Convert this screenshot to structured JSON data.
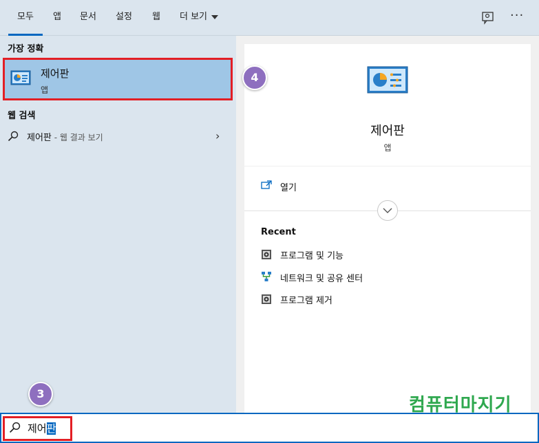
{
  "tabs": [
    {
      "label": "모두"
    },
    {
      "label": "앱"
    },
    {
      "label": "문서"
    },
    {
      "label": "설정"
    },
    {
      "label": "웹"
    },
    {
      "label": "더 보기"
    }
  ],
  "toolbar": {
    "feedback_icon": "feedback-icon",
    "more_label": "···"
  },
  "left": {
    "best_match_heading": "가장 정확",
    "best_match": {
      "title": "제어판",
      "subtitle": "앱",
      "icon": "control-panel-icon"
    },
    "web_heading": "웹 검색",
    "web_item": {
      "query": "제어판",
      "suffix": " - 웹 결과 보기",
      "icon": "search-icon"
    }
  },
  "right": {
    "title": "제어판",
    "subtitle": "앱",
    "open_label": "열기",
    "recent_heading": "Recent",
    "recent_items": [
      {
        "label": "프로그램 및 기능",
        "icon": "programs-icon"
      },
      {
        "label": "네트워크 및 공유 센터",
        "icon": "network-icon"
      },
      {
        "label": "프로그램 제거",
        "icon": "programs-icon"
      }
    ]
  },
  "search": {
    "text_plain": "제어",
    "text_selected": "판"
  },
  "annotations": {
    "step3": "3",
    "step4": "4"
  },
  "watermark": "컴퓨터마지기",
  "colors": {
    "accent": "#0067c0",
    "highlight": "#e31e24",
    "badge": "#8e6fbf",
    "selected_bg": "#9fc6e6"
  }
}
